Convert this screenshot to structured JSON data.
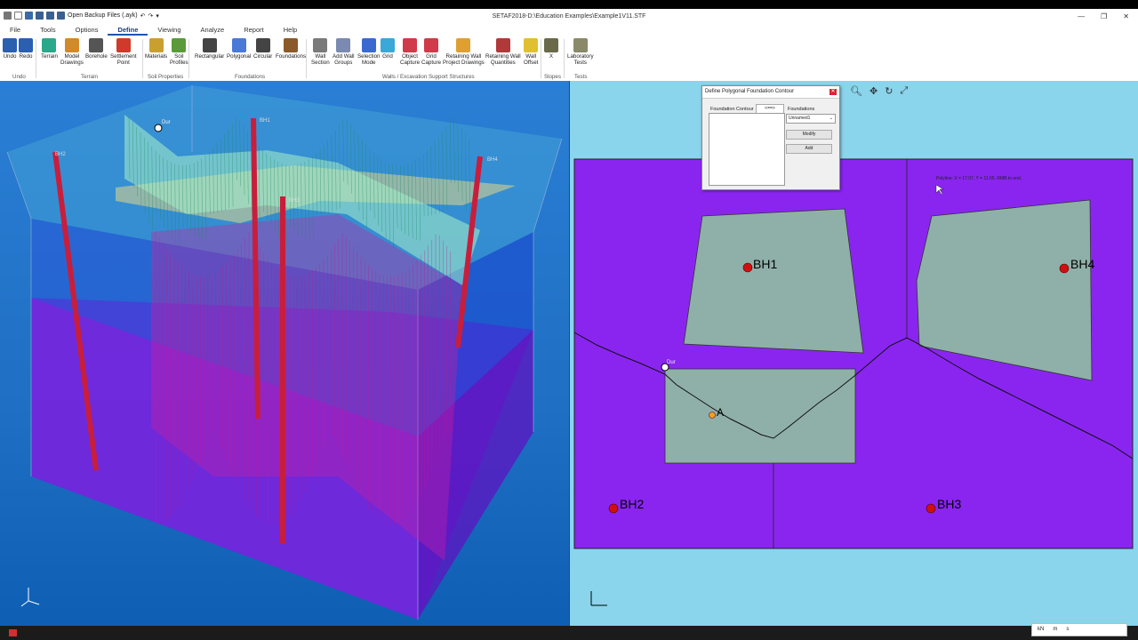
{
  "window": {
    "title": "SETAF2018-D:\\Education Examples\\Example1V11.STF",
    "quick_access_label": "Open Backup Files (.ayk)"
  },
  "menu": [
    "File",
    "Tools",
    "Options",
    "Define",
    "Viewing",
    "Analyze",
    "Report",
    "Help"
  ],
  "ribbon": {
    "buttons": [
      {
        "id": "undo",
        "label": "Undo",
        "color": "#2b5fb0"
      },
      {
        "id": "redo",
        "label": "Redo",
        "color": "#2b5fb0"
      },
      {
        "id": "terrain",
        "label": "Terrain",
        "color": "#2aa88a"
      },
      {
        "id": "model",
        "label": "Model\nDrawings",
        "color": "#d08a2a"
      },
      {
        "id": "borehole",
        "label": "Borehole",
        "color": "#555555"
      },
      {
        "id": "settlement",
        "label": "Settlement\nPoint",
        "color": "#d03a2a"
      },
      {
        "id": "materials",
        "label": "Materials",
        "color": "#c9a030"
      },
      {
        "id": "soil",
        "label": "Soil\nProfiles",
        "color": "#5a9a3a"
      },
      {
        "id": "rect",
        "label": "Rectangular",
        "color": "#444444"
      },
      {
        "id": "poly",
        "label": "Polygonal",
        "color": "#4a7ad8"
      },
      {
        "id": "circ",
        "label": "Circular",
        "color": "#444444"
      },
      {
        "id": "found",
        "label": "Foundations",
        "color": "#8a5a2a"
      },
      {
        "id": "wallsec",
        "label": "Wall\nSection",
        "color": "#7a7a7a"
      },
      {
        "id": "addwall",
        "label": "Add Wall\nGroups",
        "color": "#7a8ab0"
      },
      {
        "id": "selmode",
        "label": "Selection\nMode",
        "color": "#3a6ad0"
      },
      {
        "id": "grid",
        "label": "Grid",
        "color": "#3aa8d8"
      },
      {
        "id": "objcap",
        "label": "Object\nCapture",
        "color": "#d03a4a"
      },
      {
        "id": "gridcap",
        "label": "Grid\nCapture",
        "color": "#d03a4a"
      },
      {
        "id": "rwpd",
        "label": "Retaining Wall\nProject Drawings",
        "color": "#e0a030"
      },
      {
        "id": "rwq",
        "label": "Retaining Wall\nQuantities",
        "color": "#b03a3a"
      },
      {
        "id": "woff",
        "label": "Wall\nOffset",
        "color": "#e0c030"
      },
      {
        "id": "x",
        "label": "X",
        "color": "#6a6a4a"
      },
      {
        "id": "lab",
        "label": "Laboratory\nTests",
        "color": "#8a8a6a"
      }
    ],
    "groups": [
      {
        "label": "Undo"
      },
      {
        "label": "Terrain"
      },
      {
        "label": "Soil Properties"
      },
      {
        "label": "Foundations"
      },
      {
        "label": "Walls / Excavation Support Structures"
      },
      {
        "label": "Slopes"
      },
      {
        "label": "Tests"
      }
    ]
  },
  "plan": {
    "boreholes": [
      "BH1",
      "BH2",
      "BH3",
      "BH4"
    ],
    "point_label": "A",
    "wall_label": "Dur",
    "tooltip": "Polyline: X = 17.07, Y = 11.55. RMB to end."
  },
  "model3d": {
    "borehole_labels": [
      "BH1",
      "BH2",
      "BH3",
      "BH4"
    ],
    "wall_label": "Dur"
  },
  "dialog": {
    "title": "Define Polygonal Foundation Contour",
    "contour_label": "Foundation Contour",
    "contour_button": "<==>",
    "foundations_label": "Foundations",
    "foundations_value": "Unnamed1",
    "modify_label": "Modify",
    "add_label": "Add"
  },
  "status": {
    "units": [
      "kN",
      "m",
      "s"
    ]
  }
}
